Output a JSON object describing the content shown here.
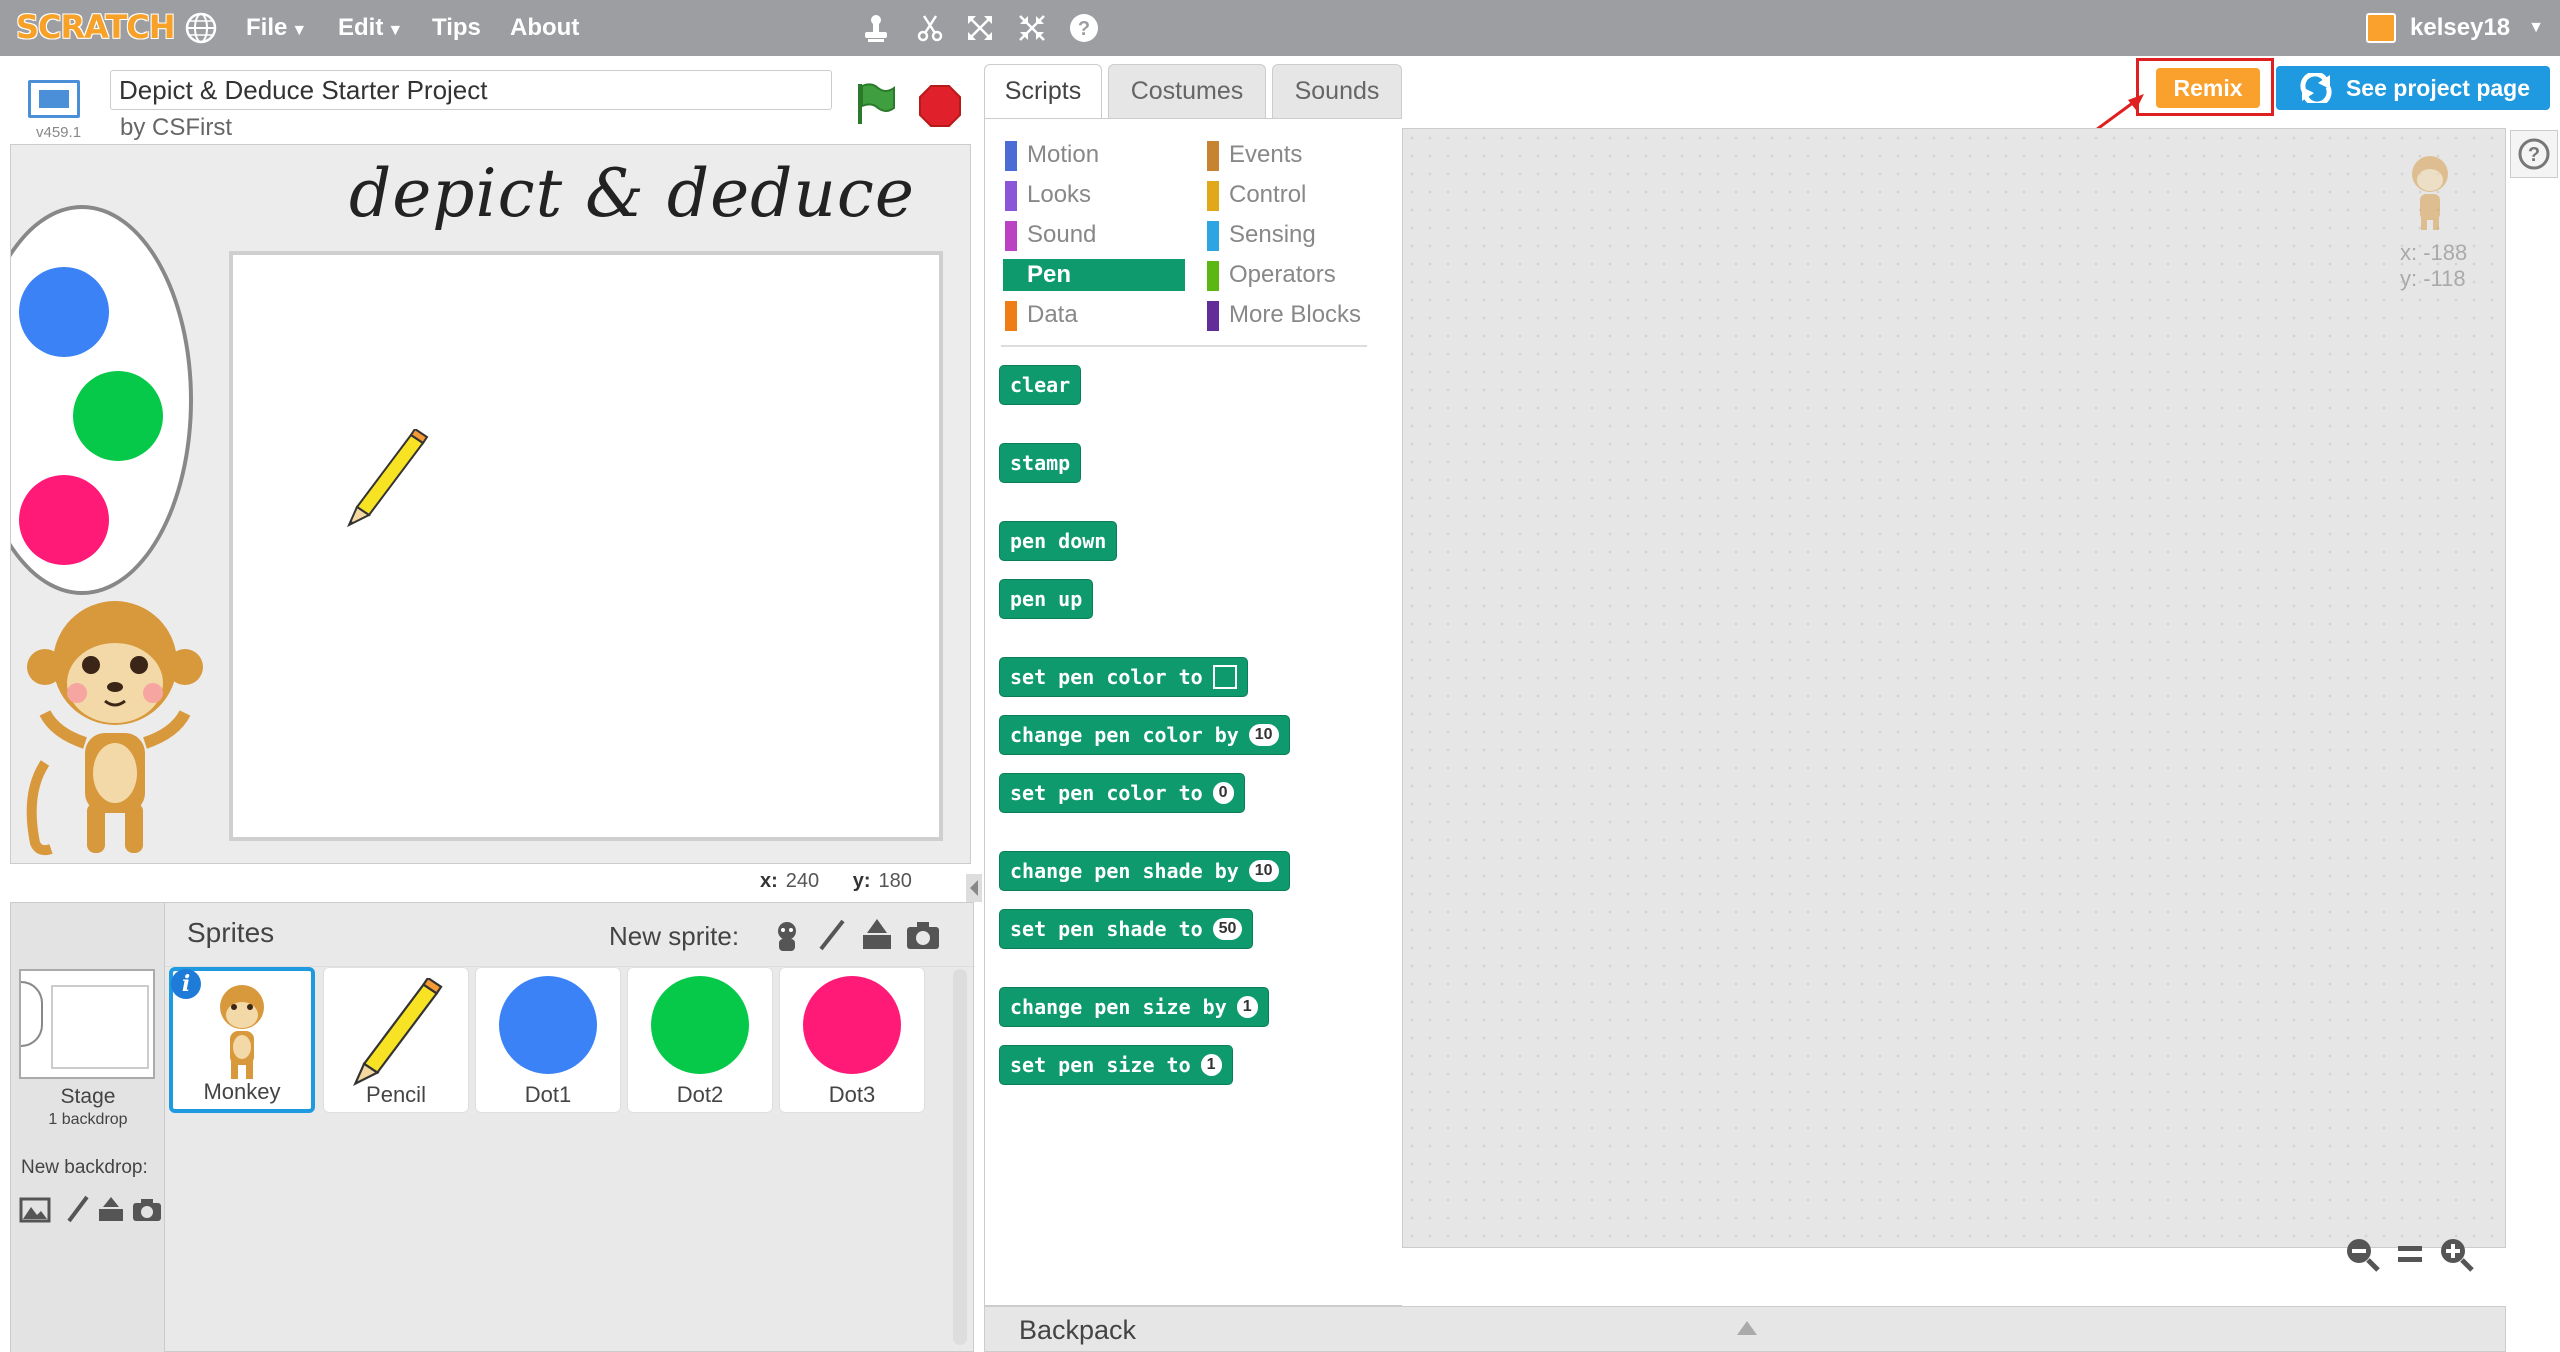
{
  "topbar": {
    "logo": "SCRATCH",
    "menu": [
      "File",
      "Edit",
      "Tips",
      "About"
    ],
    "username": "kelsey18"
  },
  "stage_header": {
    "version": "v459.1",
    "project_title": "Depict & Deduce Starter Project",
    "author": "by CSFirst"
  },
  "stage": {
    "canvas_title": "depict & deduce",
    "coord_x_label": "x:",
    "coord_x": "240",
    "coord_y_label": "y:",
    "coord_y": "180",
    "palette_colors": [
      "#3b82f6",
      "#06c94a",
      "#ff1a78"
    ]
  },
  "sprites": {
    "title": "Sprites",
    "new_sprite_label": "New sprite:",
    "stage_label": "Stage",
    "stage_backdrops": "1 backdrop",
    "new_backdrop_label": "New backdrop:",
    "items": [
      {
        "name": "Monkey",
        "selected": true
      },
      {
        "name": "Pencil"
      },
      {
        "name": "Dot1",
        "color": "#3b82f6"
      },
      {
        "name": "Dot2",
        "color": "#06c94a"
      },
      {
        "name": "Dot3",
        "color": "#ff1a78"
      }
    ]
  },
  "tabs": [
    "Scripts",
    "Costumes",
    "Sounds"
  ],
  "actions": {
    "remix": "Remix",
    "see_project_page": "See project page"
  },
  "categories": {
    "left": [
      {
        "label": "Motion",
        "color": "#4a6cd4"
      },
      {
        "label": "Looks",
        "color": "#8a55d7"
      },
      {
        "label": "Sound",
        "color": "#bb42c3"
      },
      {
        "label": "Pen",
        "color": "#0e9a6c",
        "active": true
      },
      {
        "label": "Data",
        "color": "#ee7d16"
      }
    ],
    "right": [
      {
        "label": "Events",
        "color": "#c88330"
      },
      {
        "label": "Control",
        "color": "#e1a91a"
      },
      {
        "label": "Sensing",
        "color": "#2ca5e2"
      },
      {
        "label": "Operators",
        "color": "#5cb712"
      },
      {
        "label": "More Blocks",
        "color": "#632d99"
      }
    ]
  },
  "blocks": {
    "clear": "clear",
    "stamp": "stamp",
    "pen_down": "pen down",
    "pen_up": "pen up",
    "set_pen_color_to": "set pen color to",
    "change_pen_color_by": "change pen color by",
    "change_pen_color_by_value": "10",
    "set_pen_color_to_num": "set pen color to",
    "set_pen_color_to_num_value": "0",
    "change_pen_shade_by": "change pen shade by",
    "change_pen_shade_by_value": "10",
    "set_pen_shade_to": "set pen shade to",
    "set_pen_shade_to_value": "50",
    "change_pen_size_by": "change pen size by",
    "change_pen_size_by_value": "1",
    "set_pen_size_to": "set pen size to",
    "set_pen_size_to_value": "1"
  },
  "script_area": {
    "sprite_x": "x: -188",
    "sprite_y": "y: -118"
  },
  "backpack": {
    "label": "Backpack"
  }
}
